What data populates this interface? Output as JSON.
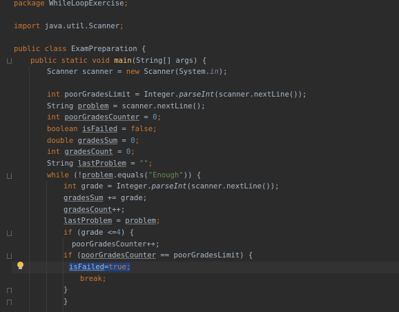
{
  "code": {
    "package_kw": "package",
    "package_name": "WhileLoopExercise",
    "semicolon": ";",
    "import_kw": "import",
    "import_name": "java.util.Scanner",
    "public_kw": "public",
    "class_kw": "class",
    "class_name": "ExamPreparation {",
    "static_kw": "static",
    "void_kw": "void",
    "main_name": "main",
    "main_args": "(String[] args) {",
    "scanner_line_a": "Scanner scanner = ",
    "new_kw": "new",
    "scanner_line_b": " Scanner(System.",
    "in_field": "in",
    "close_paren_semicolon": ");",
    "int_kw": "int",
    "poor_limit_a": " poorGradesLimit = Integer.",
    "parse_int": "parseInt",
    "poor_limit_b": "(scanner.nextLine());",
    "string_type": "String",
    "problem_var": "problem",
    "problem_b": " = scanner.nextLine();",
    "poor_counter_var": "poorGradesCounter",
    "assign": " = ",
    "zero": "0",
    "boolean_kw": "boolean",
    "is_failed_var": "isFailed",
    "false_kw": "false",
    "double_kw": "double",
    "grades_sum_var": "gradesSum",
    "grades_count_var": "gradesCount",
    "last_problem_var": "lastProblem",
    "empty_string": "\"\"",
    "while_kw": "while",
    "while_a": " (!",
    "while_b": ".equals(",
    "enough_str": "\"Enough\"",
    "while_c": ")) {",
    "grade_a": " grade = Integer.",
    "grade_b": "(scanner.nextLine());",
    "plus_assign_grade": " += grade;",
    "increment": "++;",
    "if_kw": "if",
    "if_grade": " (grade <=",
    "four": "4",
    "close_brace_open": ") {",
    "poor_inc": "poorGradesCounter++;",
    "if_counter_a": " (",
    "if_counter_b": " == poorGradesLimit) {",
    "equals_sign": "=",
    "true_kw": "true",
    "break_kw": "break",
    "close_brace": "}"
  }
}
